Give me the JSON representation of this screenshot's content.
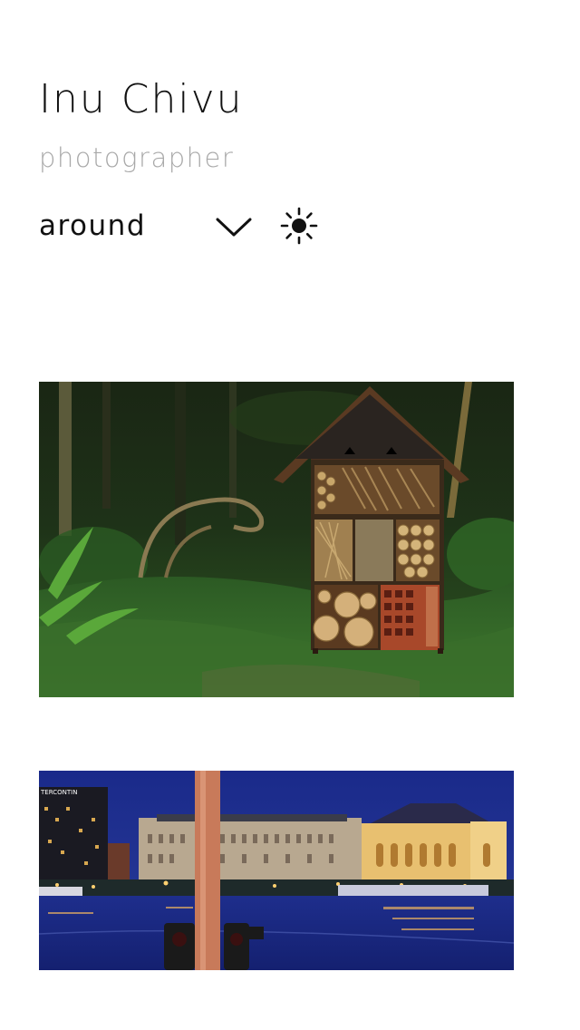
{
  "site": {
    "title": "Inu Chivu",
    "subtitle": "photographer"
  },
  "nav": {
    "current_section": "around",
    "toggle_icon": "chevron-down-icon",
    "theme_icon": "sun-icon"
  },
  "gallery": {
    "photos": [
      {
        "subject": "insect hotel in forest",
        "sign_text": ""
      },
      {
        "subject": "city riverside at night",
        "sign_text": "TERCONTIN"
      }
    ]
  },
  "colors": {
    "title": "#111111",
    "subtitle": "#a9a9a9",
    "background": "#ffffff"
  }
}
